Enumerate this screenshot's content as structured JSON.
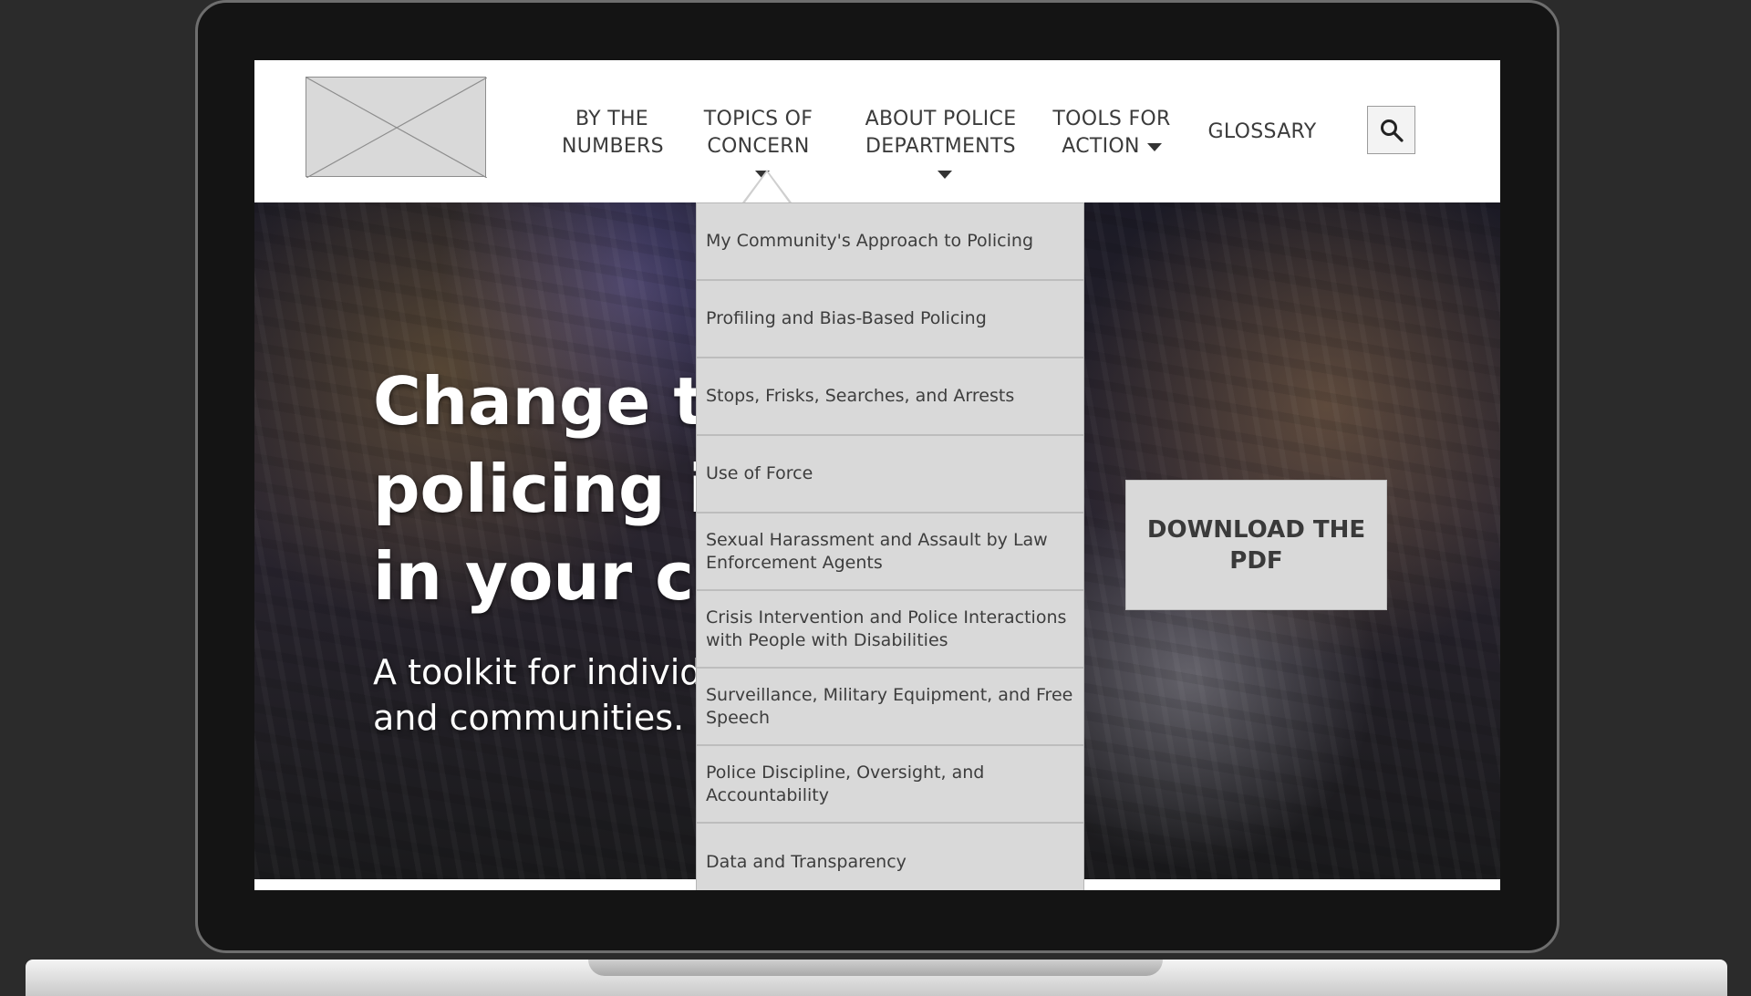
{
  "nav": {
    "logo_placeholder": "logo",
    "items": [
      {
        "label_line1": "BY THE",
        "label_line2": "NUMBERS",
        "has_dropdown": false
      },
      {
        "label_line1": "TOPICS OF",
        "label_line2": "CONCERN",
        "has_dropdown": true
      },
      {
        "label_line1": "ABOUT POLICE",
        "label_line2": "DEPARTMENTS",
        "has_dropdown": true
      },
      {
        "label_line1": "TOOLS FOR",
        "label_line2": "ACTION",
        "has_dropdown": true
      },
      {
        "label_line1": "GLOSSARY",
        "label_line2": "",
        "has_dropdown": false
      }
    ],
    "search_icon": "search-icon"
  },
  "hero": {
    "title_line1": "Change th",
    "title_line2": "policing is",
    "title_line3": "in your co",
    "subtitle_line1": "A toolkit for individ",
    "subtitle_line2": "and communities.",
    "download_label": "DOWNLOAD THE PDF"
  },
  "dropdown": {
    "items": [
      "My Community's Approach to Policing",
      "Profiling and Bias-Based Policing",
      "Stops, Frisks, Searches, and Arrests",
      "Use of Force",
      "Sexual Harassment and Assault by Law Enforcement Agents",
      "Crisis Intervention and Police Interactions with People with Disabilities",
      "Surveillance, Military Equipment, and Free Speech",
      "Police Discipline, Oversight, and Accountability",
      "Data and Transparency"
    ]
  },
  "colors": {
    "background": "#2b2b2b",
    "nav_text": "#3b3b3b",
    "dropdown_bg": "#d9d9d9",
    "button_bg": "#d9d9d9"
  }
}
